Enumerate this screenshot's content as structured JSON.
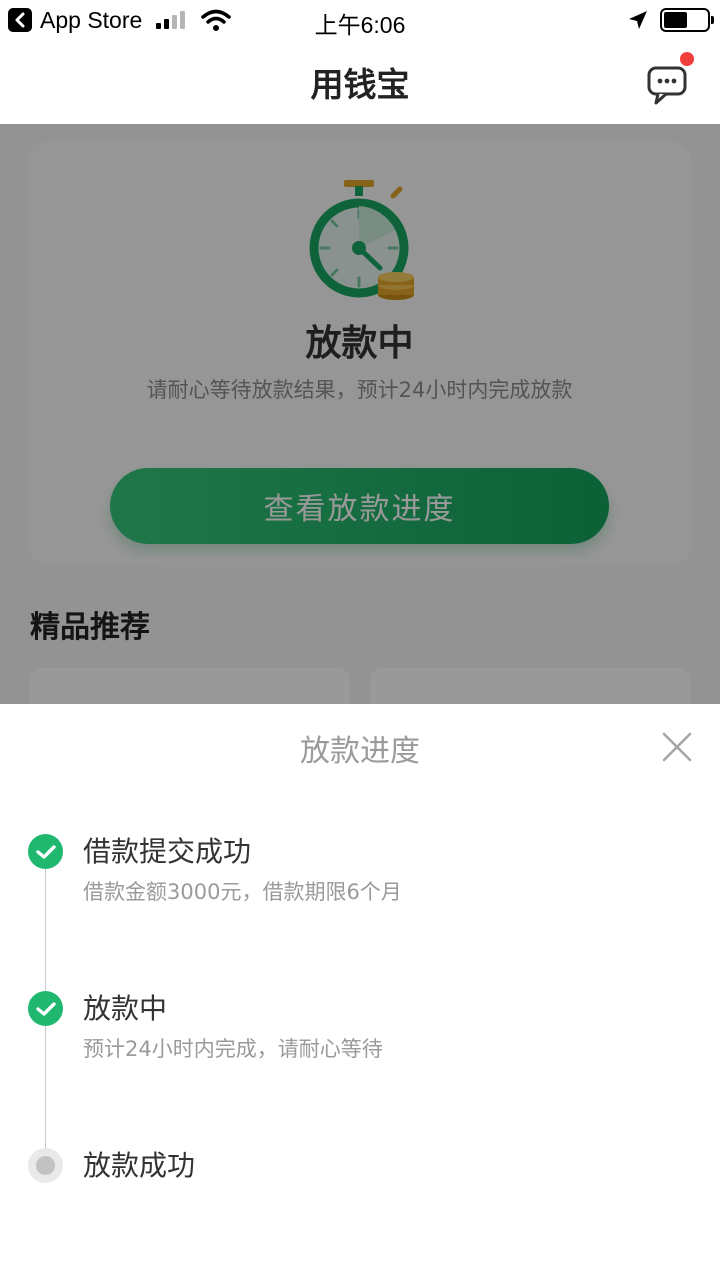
{
  "status_bar": {
    "back_app": "App Store",
    "time": "上午6:06"
  },
  "nav": {
    "title": "用钱宝",
    "message_icon": "chat-bubble-icon",
    "unread_dot_color": "#f23d3d"
  },
  "main": {
    "status_title": "放款中",
    "status_desc": "请耐心等待放款结果，预计24小时内完成放款",
    "progress_button": "查看放款进度",
    "recommend_title": "精品推荐"
  },
  "sheet": {
    "title": "放款进度",
    "close_icon": "close-icon",
    "steps": [
      {
        "title": "借款提交成功",
        "desc": "借款金额3000元，借款期限6个月",
        "state": "done"
      },
      {
        "title": "放款中",
        "desc": "预计24小时内完成，请耐心等待",
        "state": "done"
      },
      {
        "title": "放款成功",
        "desc": "",
        "state": "pending"
      }
    ]
  },
  "colors": {
    "accent_green": "#1fb86e",
    "pending_gray": "#c2c2c2"
  }
}
